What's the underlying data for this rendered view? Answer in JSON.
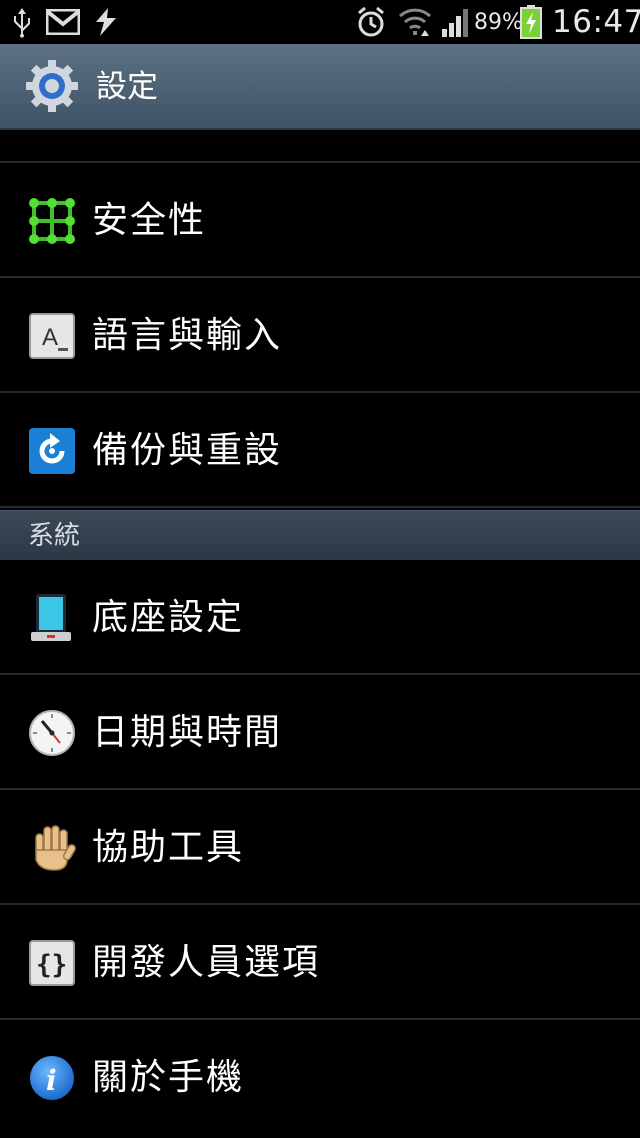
{
  "status_bar": {
    "battery_percent": "89%",
    "time": "16:47",
    "icons": [
      "usb-icon",
      "gmail-icon",
      "sync-icon",
      "alarm-icon",
      "wifi-icon",
      "signal-icon",
      "battery-charging-icon"
    ]
  },
  "action_bar": {
    "title": "設定",
    "icon": "settings-gear-icon"
  },
  "items": [
    {
      "label": "安全性",
      "icon": "security-pattern-icon"
    },
    {
      "label": "語言與輸入",
      "icon": "language-input-icon"
    },
    {
      "label": "備份與重設",
      "icon": "backup-reset-icon"
    }
  ],
  "section": {
    "label": "系統"
  },
  "system_items": [
    {
      "label": "底座設定",
      "icon": "dock-icon"
    },
    {
      "label": "日期與時間",
      "icon": "clock-icon"
    },
    {
      "label": "協助工具",
      "icon": "hand-accessibility-icon"
    },
    {
      "label": "開發人員選項",
      "icon": "developer-braces-icon"
    },
    {
      "label": "關於手機",
      "icon": "info-icon"
    }
  ],
  "colors": {
    "action_bar": "#4f6375",
    "section_header": "#334150",
    "background": "#000000"
  }
}
